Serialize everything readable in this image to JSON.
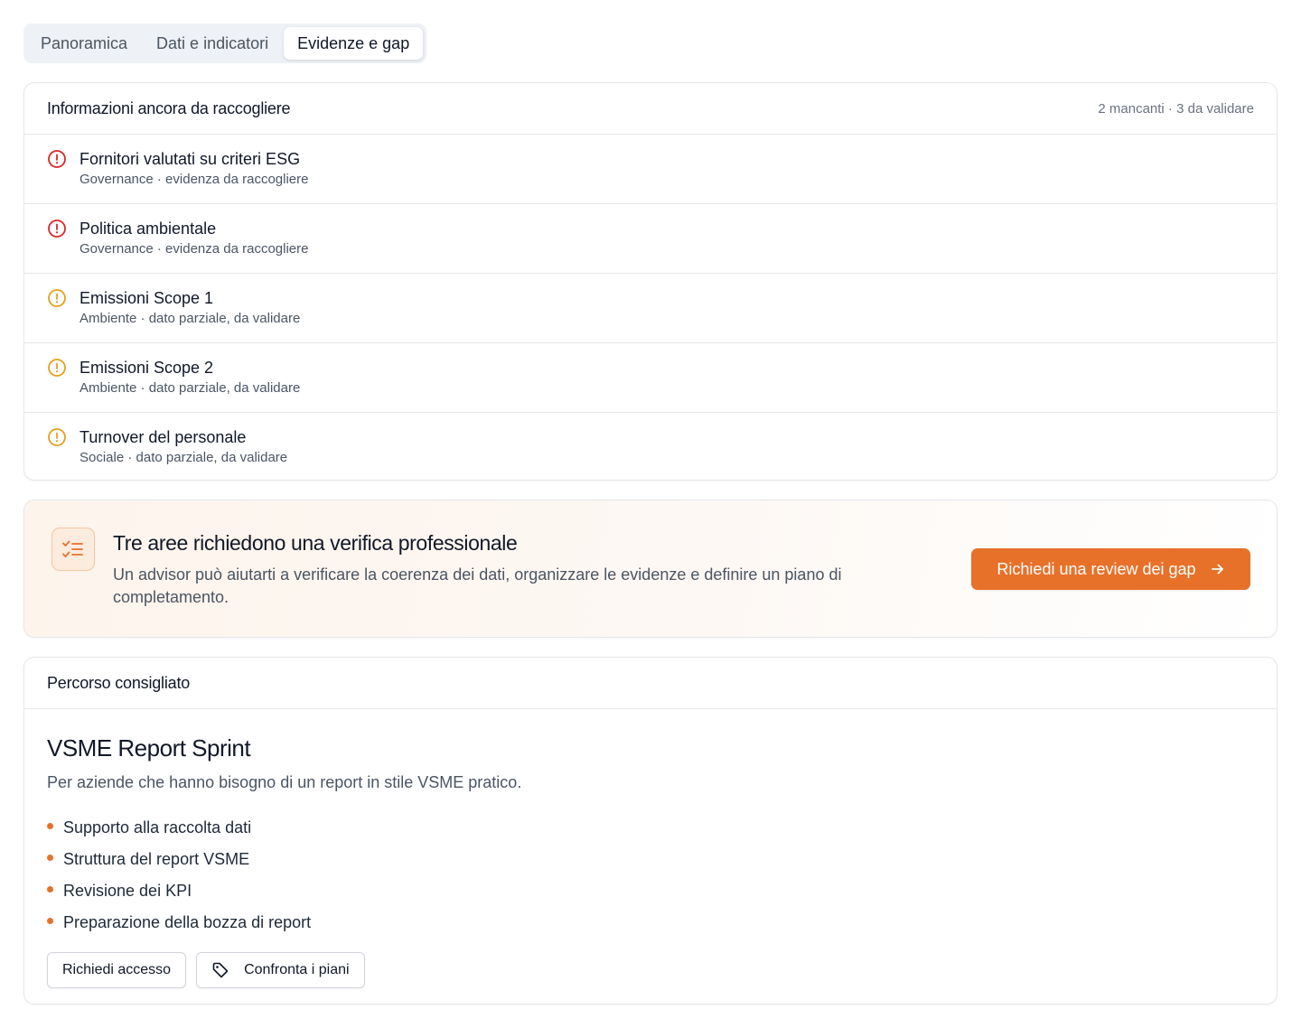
{
  "tabs": [
    {
      "label": "Panoramica",
      "active": false
    },
    {
      "label": "Dati e indicatori",
      "active": false
    },
    {
      "label": "Evidenze e gap",
      "active": true
    }
  ],
  "gaps_card": {
    "title": "Informazioni ancora da raccogliere",
    "meta": "2 mancanti · 3 da validare",
    "items": [
      {
        "title": "Fornitori valutati su criteri ESG",
        "subtitle": "Governance · evidenza da raccogliere",
        "status": "missing",
        "icon": "alert-circle-icon",
        "color": "#dc2626"
      },
      {
        "title": "Politica ambientale",
        "subtitle": "Governance · evidenza da raccogliere",
        "status": "missing",
        "icon": "alert-circle-icon",
        "color": "#dc2626"
      },
      {
        "title": "Emissioni Scope 1",
        "subtitle": "Ambiente · dato parziale, da validare",
        "status": "to-validate",
        "icon": "alert-circle-icon",
        "color": "#e5a11b"
      },
      {
        "title": "Emissioni Scope 2",
        "subtitle": "Ambiente · dato parziale, da validare",
        "status": "to-validate",
        "icon": "alert-circle-icon",
        "color": "#e5a11b"
      },
      {
        "title": "Turnover del personale",
        "subtitle": "Sociale · dato parziale, da validare",
        "status": "to-validate",
        "icon": "alert-circle-icon",
        "color": "#e5a11b"
      }
    ]
  },
  "cta": {
    "icon": "list-checks-icon",
    "title": "Tre aree richiedono una verifica professionale",
    "description": "Un advisor può aiutarti a verificare la coerenza dei dati, organizzare le evidenze e definire un piano di completamento.",
    "button_label": "Richiedi una review dei gap",
    "accent": "#e8712a"
  },
  "plan": {
    "header": "Percorso consigliato",
    "title": "VSME Report Sprint",
    "description": "Per aziende che hanno bisogno di un report in stile VSME pratico.",
    "features": [
      "Supporto alla raccolta dati",
      "Struttura del report VSME",
      "Revisione dei KPI",
      "Preparazione della bozza di report"
    ],
    "primary_action": "Richiedi accesso",
    "secondary_action": "Confronta i piani"
  }
}
